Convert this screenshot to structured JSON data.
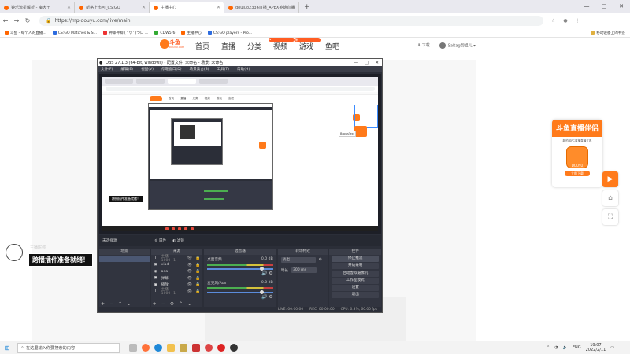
{
  "browser": {
    "tabs": [
      {
        "label": "钟乐流星解析 - 魔大王",
        "active": false
      },
      {
        "label": "新格上市可_CS:GO",
        "active": false
      },
      {
        "label": "主播中心",
        "active": true
      },
      {
        "label": "douluo2336直播_APEX英雄直播",
        "active": false
      }
    ],
    "new_tab": "+",
    "window_controls": [
      "—",
      "□",
      "✕"
    ],
    "url": "https://mp.douyu.com/live/main",
    "bookmarks": [
      "斗鱼 - 每个人的直播...",
      "CS:GO Matches & S...",
      "神唧神唧 ( ' ▽ ' )つロ ...",
      "CDW5r6",
      "主播中心",
      "CS:GO players - Pro..."
    ],
    "bookmarks_right": "移动设备上的书签"
  },
  "douyu": {
    "logo_text": "斗鱼",
    "logo_sub": "DOUYU.COM",
    "nav": [
      {
        "label": "首页",
        "badge": ""
      },
      {
        "label": "直播",
        "badge": ""
      },
      {
        "label": "分类",
        "badge": ""
      },
      {
        "label": "视频",
        "badge": "•"
      },
      {
        "label": "游戏",
        "badge": "新"
      },
      {
        "label": "鱼吧",
        "badge": ""
      }
    ],
    "download_label": "下载",
    "user_name": "Saltag御姐儿"
  },
  "obs": {
    "title": "OBS 27.1.3 (64-bit, windows) - 配置文件: 未命名 - 场景: 未命名",
    "menu": [
      "文件(F)",
      "编辑(E)",
      "视图(V)",
      "停靠窗口(D)",
      "场景集合(S)",
      "工具(T)",
      "帮助(H)"
    ],
    "scene_bar": {
      "current": "未选择源",
      "properties": "属性",
      "filters": "滤镜"
    },
    "docks": {
      "scenes": "场景",
      "sources": "来源",
      "mixer": "混音器",
      "transitions": "转场特效",
      "controls": "控件"
    },
    "sources": [
      {
        "icon": "T",
        "name": "主播 1000+1",
        "dim": true
      },
      {
        "icon": "▣",
        "name": "viad",
        "dim": false
      },
      {
        "icon": "◉",
        "name": "ada",
        "dim": false
      },
      {
        "icon": "▣",
        "name": "弹幕",
        "dim": false
      },
      {
        "icon": "▣",
        "name": "播放",
        "dim": false
      },
      {
        "icon": "T",
        "name": "主播 1000+1",
        "dim": true
      }
    ],
    "mixer": [
      {
        "name": "桌面音频",
        "db": "0.0 dB"
      },
      {
        "name": "麦克风/Aux",
        "db": "0.0 dB"
      }
    ],
    "transition": {
      "type": "淡出",
      "duration_label": "时长",
      "duration_value": "300 ms"
    },
    "controls": [
      "停止推流",
      "开始录制",
      "启动虚拟摄像机",
      "工作室模式",
      "设置",
      "退出"
    ],
    "status": [
      "LIVE: 00:00:00",
      "REC: 00:00:00",
      "CPU: 0.3%, 60.00 fps"
    ]
  },
  "preview": {
    "banner": "跨播插件准备就绪！",
    "float_label": "BrowsText"
  },
  "overlay": {
    "ghost_name": "主播昵称",
    "status_banner": "跨播插件准备就绪！"
  },
  "promo": {
    "title": "斗鱼直播伴侣",
    "subtitle": "新的和PC直播直播工具",
    "icon_label": "DOUYU",
    "button": "立即下载"
  },
  "side_buttons": [
    "▶",
    "⌂",
    "⛶"
  ],
  "taskbar": {
    "search_placeholder": "在这里输入你要搜索的内容",
    "tray": {
      "lang": "ENG",
      "time": "19:07",
      "date": "2022/2/11"
    }
  },
  "colors": {
    "brand": "#ff7a1a",
    "obs_bg": "#2b2e38",
    "accent_blue": "#3c8cff"
  }
}
